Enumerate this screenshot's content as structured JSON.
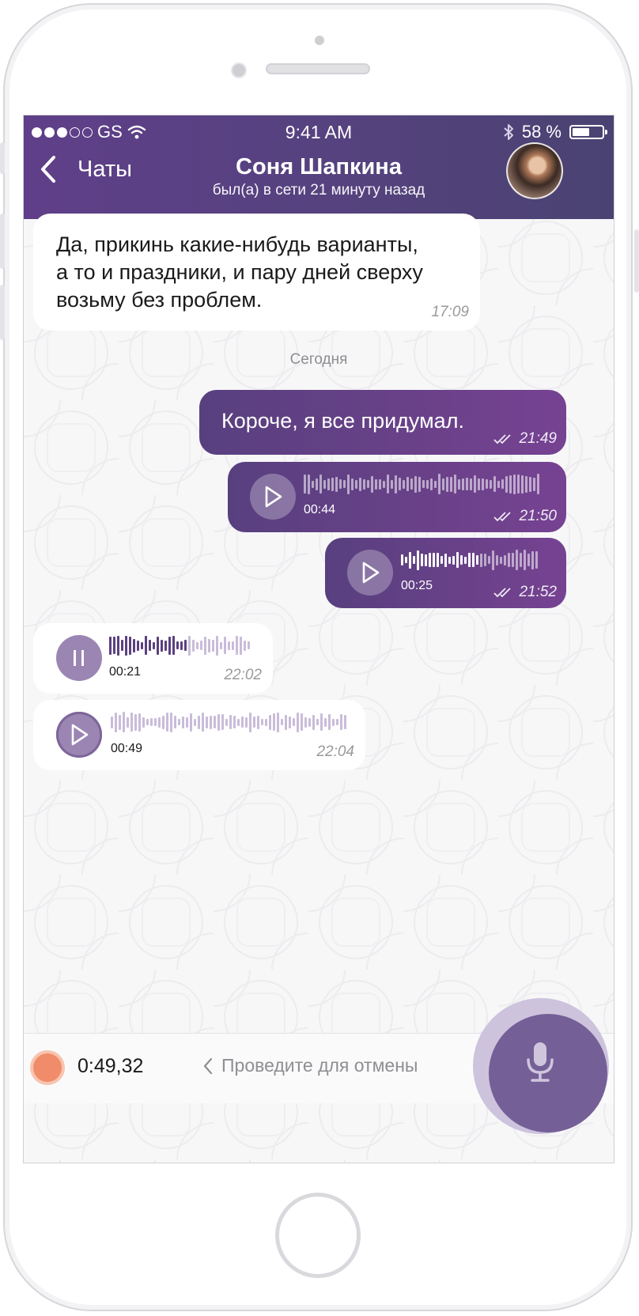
{
  "status_bar": {
    "carrier": "GS",
    "time": "9:41 AM",
    "battery": "58 %",
    "battery_level": 0.58
  },
  "header": {
    "back_label": "Чаты",
    "contact_name": "Соня Шапкина",
    "contact_status": "был(а) в сети 21 минуту назад"
  },
  "messages": [
    {
      "direction": "in",
      "text_lines": [
        "Да, прикинь какие-нибудь варианты,",
        "а то и праздники, и пару дней сверху",
        "возьму без проблем."
      ],
      "time": "17:09"
    },
    {
      "direction": "date",
      "text": "Сегодня"
    },
    {
      "direction": "out",
      "text": "Короче, я все придумал.",
      "time": "21:49"
    },
    {
      "direction": "out",
      "type": "voice",
      "duration": "00:44",
      "time": "21:50"
    },
    {
      "direction": "out",
      "type": "voice",
      "duration": "00:25",
      "time": "21:52"
    },
    {
      "direction": "in",
      "type": "voice",
      "state": "playing",
      "duration": "00:21",
      "time": "22:02",
      "progress": 0.55
    },
    {
      "direction": "in",
      "type": "voice",
      "state": "paused",
      "duration": "00:49",
      "time": "22:04"
    }
  ],
  "input_bar": {
    "record_time": "0:49,32",
    "cancel_hint": "Проведите для отмены"
  },
  "colors": {
    "header": "#55427e",
    "outgoing_bubble": "#6a4189",
    "accent_light": "#9b86b3",
    "record_dot": "#f08c69",
    "mic_button": "#745f97"
  }
}
